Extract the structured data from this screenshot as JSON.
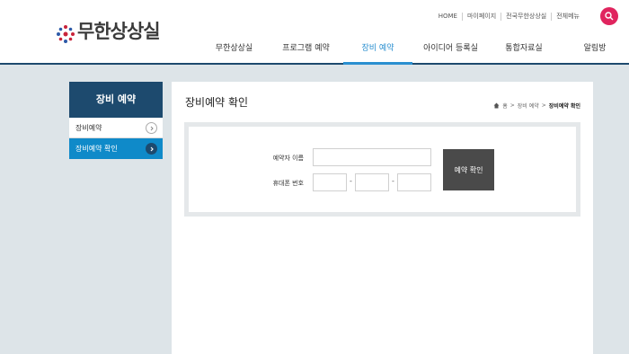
{
  "brand": {
    "logo_text": "무한상상실"
  },
  "util_nav": [
    "HOME",
    "마이페이지",
    "전국무한상상실",
    "전체메뉴"
  ],
  "gnb": [
    {
      "label": "무한상상실",
      "active": false
    },
    {
      "label": "프로그램 예약",
      "active": false
    },
    {
      "label": "장비 예약",
      "active": true
    },
    {
      "label": "아이디어 등록실",
      "active": false
    },
    {
      "label": "통합자료실",
      "active": false
    },
    {
      "label": "알림방",
      "active": false
    }
  ],
  "lnb": {
    "title": "장비 예약",
    "items": [
      {
        "label": "장비예약",
        "active": false
      },
      {
        "label": "장비예약 확인",
        "active": true
      }
    ]
  },
  "page": {
    "title": "장비예약 확인",
    "breadcrumb": [
      "홈",
      "장비 예약",
      "장비예약 확인"
    ]
  },
  "form": {
    "name_label": "예약자 이름",
    "phone_label": "휴대폰 번호",
    "phone_sep": "-",
    "submit_label": "예약 확인"
  },
  "colors": {
    "primary": "#1d4a6e",
    "accent": "#0f8ac9",
    "active_menu": "#2a8fd0",
    "search": "#e0245e"
  }
}
